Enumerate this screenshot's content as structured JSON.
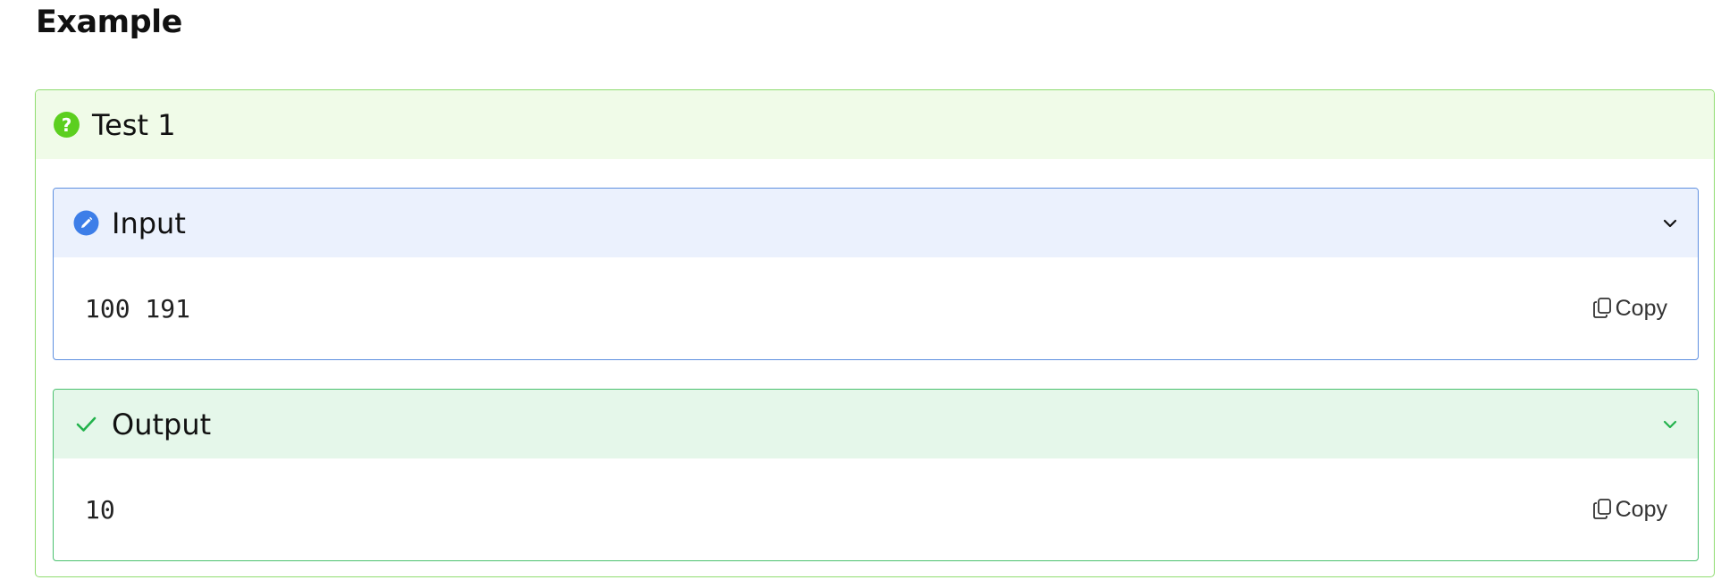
{
  "section": {
    "title": "Example"
  },
  "test": {
    "title": "Test 1",
    "icon": "help-icon",
    "accent": "#5ccf1f"
  },
  "input_panel": {
    "title": "Input",
    "icon": "pencil-icon",
    "value": "100 191",
    "copy_label": "Copy",
    "accent": "#3d7ee8"
  },
  "output_panel": {
    "title": "Output",
    "icon": "check-icon",
    "value": "10",
    "copy_label": "Copy",
    "accent": "#22b24c"
  }
}
